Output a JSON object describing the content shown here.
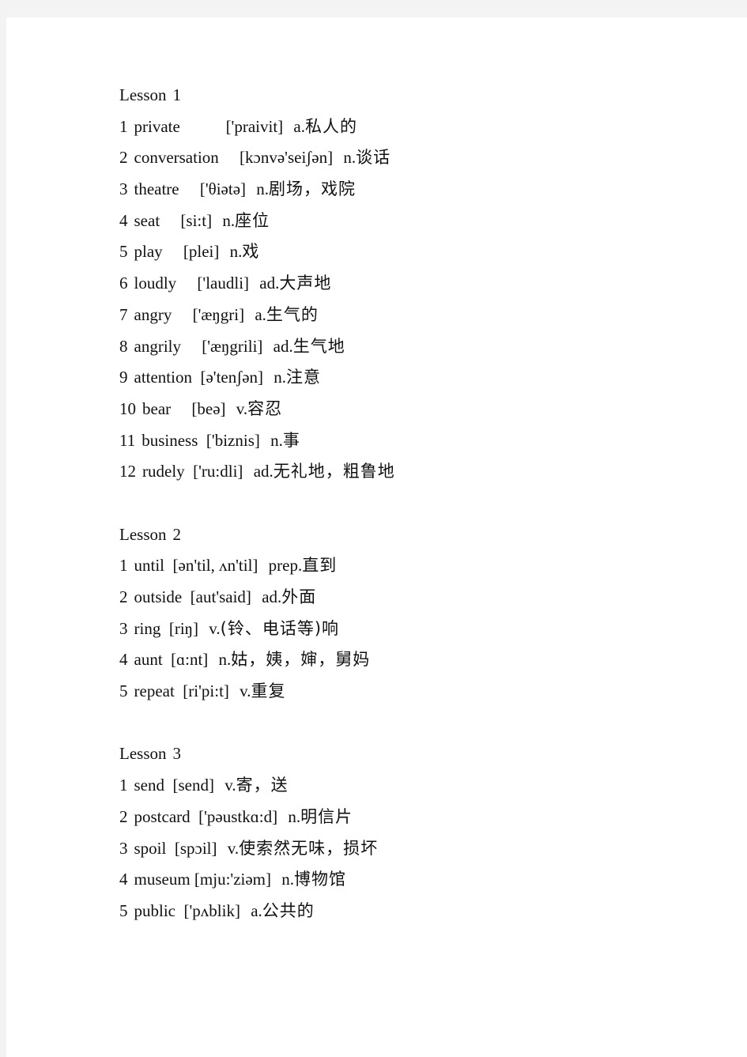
{
  "document": {
    "lessons": [
      {
        "label": "Lesson",
        "number": "1",
        "items": [
          {
            "num": "1",
            "word": "private",
            "spacer": "          ",
            "pron": "['praivit]",
            "pos": "a.",
            "meaning": "私人的"
          },
          {
            "num": "2",
            "word": "conversation",
            "spacer": "    ",
            "pron": "[kɔnvə'seiʃən]",
            "pos": "n.",
            "meaning": "谈话"
          },
          {
            "num": "3",
            "word": "theatre",
            "spacer": "    ",
            "pron": "['θiətə]",
            "pos": "n.",
            "meaning": "剧场，戏院"
          },
          {
            "num": "4",
            "word": "seat",
            "spacer": "    ",
            "pron": "[si:t]",
            "pos": "n.",
            "meaning": "座位"
          },
          {
            "num": "5",
            "word": "play",
            "spacer": "    ",
            "pron": "[plei]",
            "pos": "n.",
            "meaning": "戏"
          },
          {
            "num": "6",
            "word": "loudly",
            "spacer": "    ",
            "pron": "['laudli]",
            "pos": "ad.",
            "meaning": "大声地"
          },
          {
            "num": "7",
            "word": "angry",
            "spacer": "    ",
            "pron": "['æŋgri]",
            "pos": "a.",
            "meaning": "生气的"
          },
          {
            "num": "8",
            "word": "angrily",
            "spacer": "    ",
            "pron": "['æŋgrili]",
            "pos": "ad.",
            "meaning": "生气地"
          },
          {
            "num": "9",
            "word": "attention",
            "spacer": " ",
            "pron": "[ə'tenʃən]",
            "pos": "n.",
            "meaning": "注意"
          },
          {
            "num": "10",
            "word": "bear",
            "spacer": "    ",
            "pron": "[beə]",
            "pos": "v.",
            "meaning": "容忍"
          },
          {
            "num": "11",
            "word": "business",
            "spacer": " ",
            "pron": "['biznis]",
            "pos": "n.",
            "meaning": "事"
          },
          {
            "num": "12",
            "word": "rudely",
            "spacer": " ",
            "pron": "['ru:dli]",
            "pos": "ad.",
            "meaning": "无礼地，粗鲁地"
          }
        ]
      },
      {
        "label": "Lesson",
        "number": "2",
        "items": [
          {
            "num": "1",
            "word": "until",
            "spacer": " ",
            "pron": "[ən'til, ʌn'til]",
            "pos": "prep.",
            "meaning": "直到"
          },
          {
            "num": "2",
            "word": "outside",
            "spacer": " ",
            "pron": "[aut'said]",
            "pos": "ad.",
            "meaning": "外面"
          },
          {
            "num": "3",
            "word": "ring",
            "spacer": " ",
            "pron": "[riŋ]",
            "pos": "v.",
            "meaning": "(铃、电话等)响"
          },
          {
            "num": "4",
            "word": "aunt",
            "spacer": " ",
            "pron": "[ɑ:nt]",
            "pos": "n.",
            "meaning": "姑，姨，婶，舅妈"
          },
          {
            "num": "5",
            "word": "repeat",
            "spacer": " ",
            "pron": "[ri'pi:t]",
            "pos": "v.",
            "meaning": "重复"
          }
        ]
      },
      {
        "label": "Lesson",
        "number": "3",
        "items": [
          {
            "num": "1",
            "word": "send",
            "spacer": " ",
            "pron": "[send]",
            "pos": "v.",
            "meaning": "寄，送"
          },
          {
            "num": "2",
            "word": "postcard",
            "spacer": " ",
            "pron": "['pəustkɑ:d]",
            "pos": "n.",
            "meaning": "明信片"
          },
          {
            "num": "3",
            "word": "spoil",
            "spacer": " ",
            "pron": "[spɔil]",
            "pos": "v.",
            "meaning": "使索然无味，损坏"
          },
          {
            "num": "4",
            "word": "museum",
            "spacer": "",
            "pron": "[mju:'ziəm]",
            "pos": "n.",
            "meaning": "博物馆"
          },
          {
            "num": "5",
            "word": "public",
            "spacer": " ",
            "pron": "['pʌblik]",
            "pos": "a.",
            "meaning": "公共的"
          }
        ]
      }
    ]
  }
}
